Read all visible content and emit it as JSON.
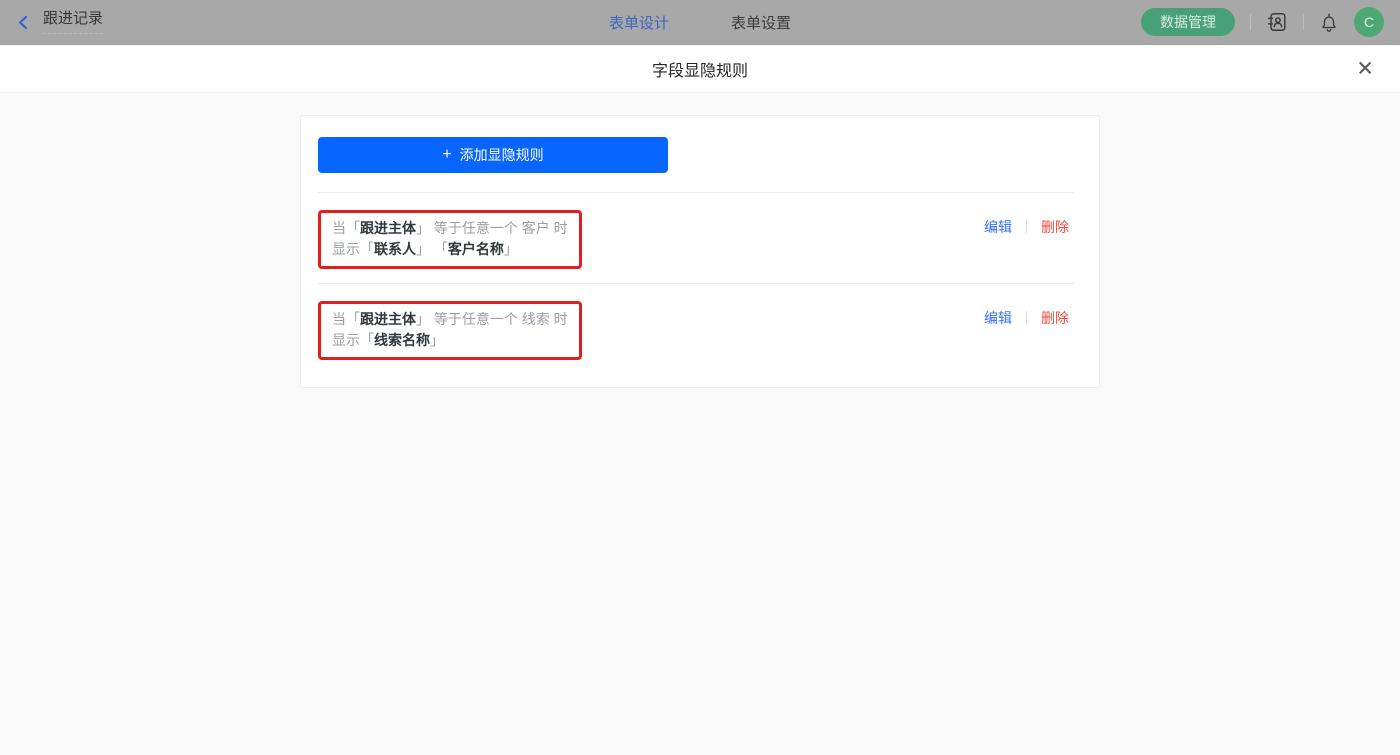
{
  "topbar": {
    "back_label": "跟进记录",
    "tabs": [
      {
        "label": "表单设计",
        "active": true
      },
      {
        "label": "表单设置",
        "active": false
      }
    ],
    "data_manage_label": "数据管理",
    "icons": [
      "back-chevron-icon",
      "contacts-book-icon",
      "bell-icon"
    ],
    "avatar_text": "C"
  },
  "modal": {
    "title": "字段显隐规则",
    "close_glyph": "✕"
  },
  "panel": {
    "add_plus": "+",
    "add_rule_label": "添加显隐规则",
    "edit_label": "编辑",
    "delete_label": "删除",
    "rules": [
      {
        "lines": [
          [
            {
              "text": "当「",
              "muted": true
            },
            {
              "text": "跟进主体",
              "muted": false
            },
            {
              "text": "」 等于任意一个 客户 时",
              "muted": true
            }
          ],
          [
            {
              "text": "显示「",
              "muted": true
            },
            {
              "text": "联系人",
              "muted": false
            },
            {
              "text": "」 「",
              "muted": true
            },
            {
              "text": "客户名称",
              "muted": false
            },
            {
              "text": "」",
              "muted": true
            }
          ]
        ]
      },
      {
        "lines": [
          [
            {
              "text": "当「",
              "muted": true
            },
            {
              "text": "跟进主体",
              "muted": false
            },
            {
              "text": "」 等于任意一个 线索 时",
              "muted": true
            }
          ],
          [
            {
              "text": "显示「",
              "muted": true
            },
            {
              "text": "线索名称",
              "muted": false
            },
            {
              "text": "」",
              "muted": true
            }
          ]
        ]
      }
    ]
  },
  "colors": {
    "accent_blue": "#0666ff",
    "link_blue": "#3370ff",
    "danger_red": "#f5483f",
    "annotation_red": "#e11f1f",
    "topbar_gray": "#a8a8a8",
    "pill_green": "#47a077"
  }
}
